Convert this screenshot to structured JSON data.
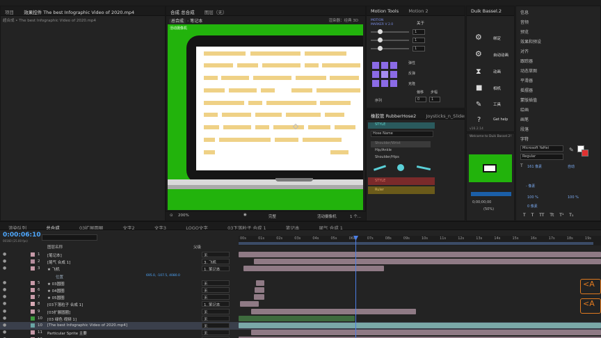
{
  "project_panel": {
    "tabs": [
      "项目",
      "效果控件 The best Infographic Video of 2020.mp4"
    ],
    "file_path": "超合成 • The best Infographic Video of 2020.mp4"
  },
  "comp_panel": {
    "tabs": [
      "合成 总合成",
      "图层（无）"
    ],
    "breadcrumb": [
      "总合成",
      "笔记本"
    ],
    "renderer_label": "渲染器：经典 3D",
    "comp_label": "活动摄像机",
    "zoom": "200%",
    "quality": "完整",
    "camera": "活动摄像机",
    "views": "1 个..."
  },
  "motion_tools": {
    "tabs": [
      "Motion Tools",
      "Motion 2"
    ],
    "title": "MOTION\nMARKER V 2.0",
    "section": "关于",
    "slider_values": [
      "1",
      "1",
      "1"
    ],
    "labels": [
      "弹性",
      "反弹",
      "克隆"
    ],
    "sequence_label": "序列",
    "step_labels": [
      "偏移",
      "步幅"
    ],
    "step_values": [
      "0",
      "1"
    ]
  },
  "duik_panel": {
    "tab": "Duik Bassel.2",
    "items": [
      "绑定",
      "自动动画",
      "动画",
      "相机",
      "工具",
      "Get help"
    ],
    "version": "v16.2.14",
    "welcome": "Welcome to Duik Bassel.2!"
  },
  "rubberhose_panel": {
    "tabs": [
      "橡胶管 RubberHose2",
      "Joysticks_n_Sliders"
    ],
    "style_label": "STYLE",
    "hose_name": "Hose Name",
    "hoses": [
      "Shoulder/Wrist",
      "Hip/Ankle",
      "Shoulder/Hips"
    ],
    "status_labels": [
      "STYLE",
      "Ruler"
    ]
  },
  "right_panel": {
    "items": [
      "信息",
      "音频",
      "预览",
      "效果和预设",
      "对齐",
      "跟踪器",
      "动态草图",
      "平滑器",
      "摇摆器",
      "蒙版插值",
      "绘画",
      "画笔",
      "段落",
      "字符"
    ],
    "font_name": "Microsoft YaHei",
    "font_style": "Regular",
    "font_size": "161 像素",
    "leading": "自动",
    "px": "- 像素",
    "percent_values": [
      "100 %",
      "100 %"
    ],
    "zero": "0 像素",
    "ts_labels": [
      "T",
      "T",
      "TT",
      "Tt",
      "T¹",
      "T₁"
    ],
    "preview_time": "0;00;00;00",
    "preview_zoom": "(50%)"
  },
  "timeline": {
    "tabs": [
      "渲染队列",
      "总合成",
      "03扩展圆圈",
      "文字2",
      "文字3",
      "LOGO文字",
      "03下落粒子 合成 1",
      "笔记本",
      "尾气 合成 1"
    ],
    "timecode": "0:00:06:10",
    "timecode_sub": "00160 (25.00 fps)",
    "search_placeholder": "",
    "col_layer_name": "图层名称",
    "col_parent": "父级",
    "ruler_labels": [
      "00s",
      "01s",
      "02s",
      "03s",
      "04s",
      "05s",
      "06s",
      "07s",
      "08s",
      "09s",
      "10s",
      "11s",
      "12s",
      "13s",
      "14s",
      "15s",
      "16s",
      "17s",
      "18s",
      "19s"
    ],
    "layers": [
      {
        "num": "1",
        "name": "[笔记本]",
        "parent": "无",
        "color": "#c79aa8"
      },
      {
        "num": "2",
        "name": "[尾气 合成 1]",
        "parent": "3. 飞机",
        "color": "#b58c9c"
      },
      {
        "num": "3",
        "name": "★ 飞机",
        "parent": "1. 笔记本",
        "color": "#c79aa8"
      },
      {
        "num": "",
        "name": "位置",
        "parent": "",
        "color": "",
        "sub": true,
        "value": "695.0, -107.5, 4080.0"
      },
      {
        "num": "5",
        "name": "★ 03圆圈",
        "parent": "无",
        "color": "#c79aa8"
      },
      {
        "num": "6",
        "name": "★ 04圆圈",
        "parent": "无",
        "color": "#c79aa8"
      },
      {
        "num": "7",
        "name": "★ 05圆圈",
        "parent": "无",
        "color": "#c79aa8"
      },
      {
        "num": "8",
        "name": "[03下落粒子 合成 1]",
        "parent": "1. 笔记本",
        "color": "#d7a9b4"
      },
      {
        "num": "9",
        "name": "[03扩展圆圈]",
        "parent": "无",
        "color": "#c79aa8"
      },
      {
        "num": "10",
        "name": "[03 绿色 视频 1]",
        "parent": "无",
        "color": "#3e9a3e"
      },
      {
        "num": "10",
        "name": "[The best Infographic Video of 2020.mp4]",
        "parent": "无",
        "color": "#6aa5a5",
        "selected": true
      },
      {
        "num": "11",
        "name": "Particular Sprite 主要",
        "parent": "无",
        "color": "#c79aa8"
      },
      {
        "num": "12",
        "name": "Particular Sprite 主要",
        "parent": "无",
        "color": "#c79aa8"
      }
    ],
    "ae_badge": "<A"
  },
  "colors": {
    "accent": "#2d8ceb",
    "green_screen": "#22b30c",
    "playhead": "#4c7fe6",
    "bar_pink": "#8f7a85",
    "bar_teal": "#7aa8a8",
    "bar_gray": "#7f7f7f"
  }
}
